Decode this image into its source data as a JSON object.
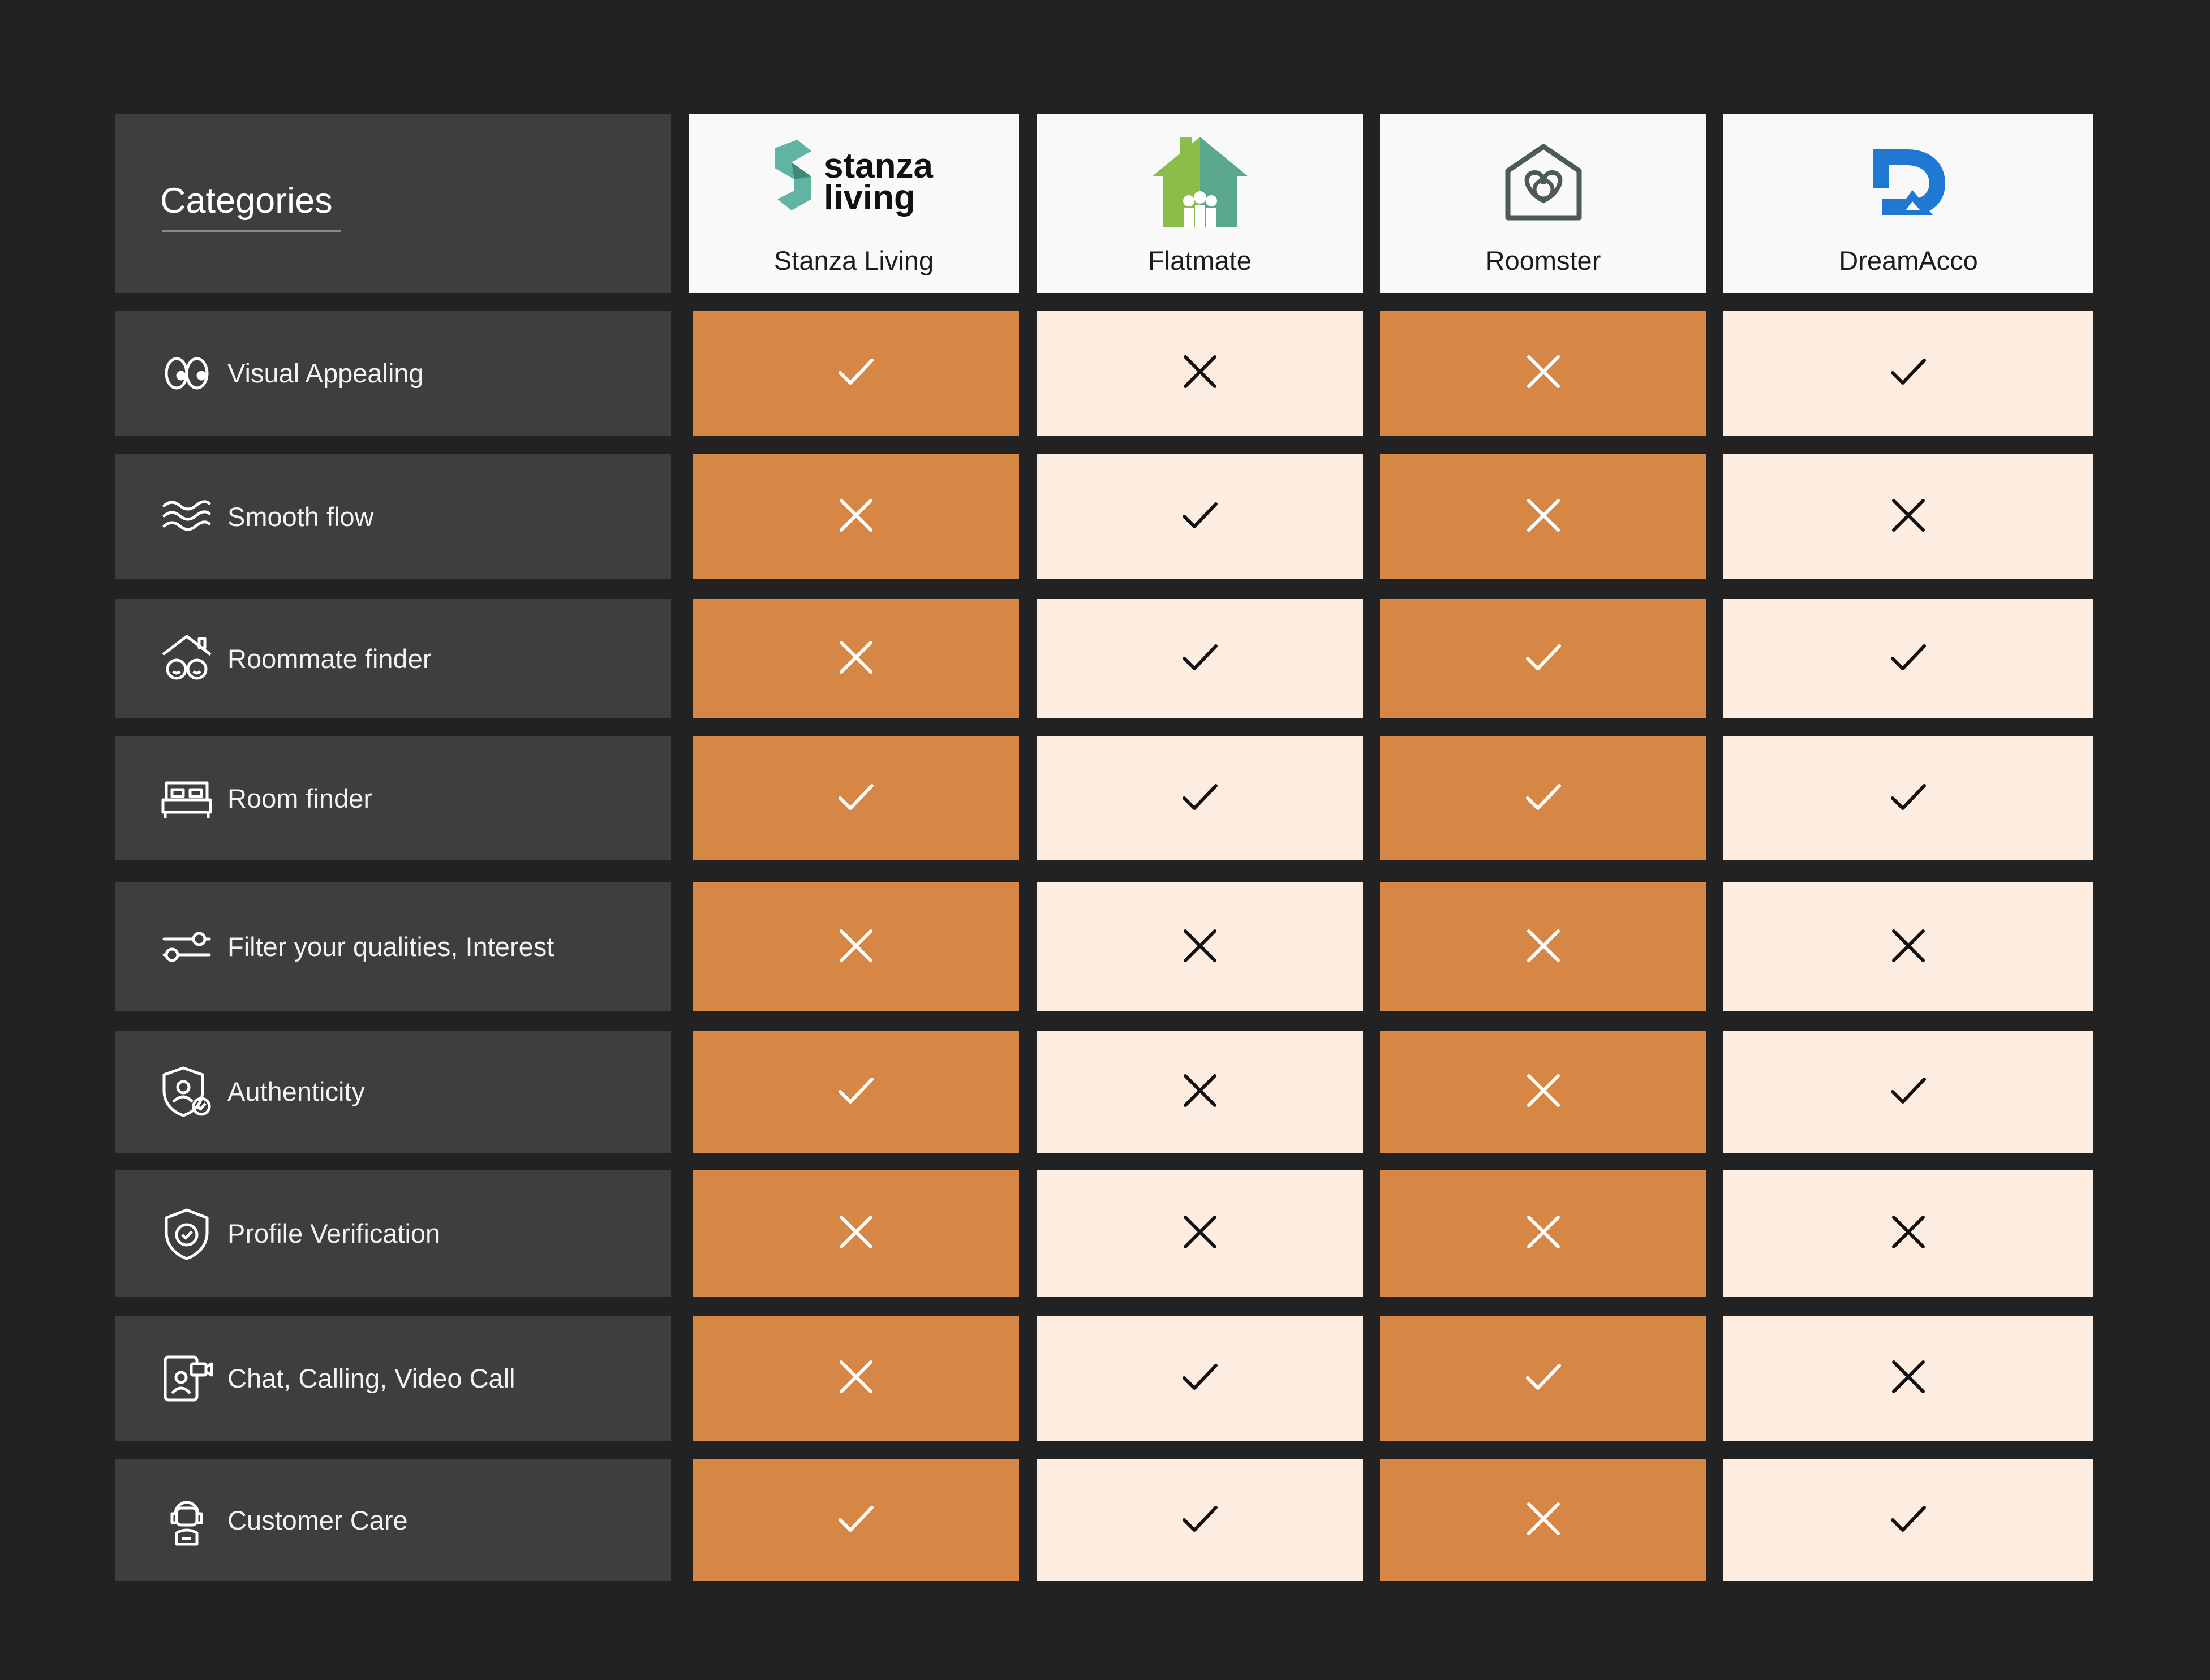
{
  "header": {
    "categories_label": "Categories"
  },
  "brands": [
    {
      "name": "Stanza Living",
      "logo_text_1": "stanza",
      "logo_text_2": "living",
      "logo": "stanza-living-logo"
    },
    {
      "name": "Flatmate",
      "logo": "flatmate-house-logo"
    },
    {
      "name": "Roomster",
      "logo": "roomster-logo"
    },
    {
      "name": "DreamAcco",
      "logo": "dreamacco-logo"
    }
  ],
  "colors": {
    "background": "#222222",
    "panel": "#3e3e3e",
    "orange": "#d68645",
    "cream": "#fdede0"
  },
  "rows": [
    {
      "label": "Visual Appealing",
      "icon": "eyes-icon",
      "values": [
        true,
        false,
        false,
        true
      ]
    },
    {
      "label": "Smooth flow",
      "icon": "waves-icon",
      "values": [
        false,
        true,
        false,
        false
      ]
    },
    {
      "label": "Roommate finder",
      "icon": "roommates-house-icon",
      "values": [
        false,
        true,
        true,
        true
      ]
    },
    {
      "label": "Room finder",
      "icon": "bed-icon",
      "values": [
        true,
        true,
        true,
        true
      ]
    },
    {
      "label": "Filter your qualities, Interest",
      "icon": "filter-sliders-icon",
      "values": [
        false,
        false,
        false,
        false
      ]
    },
    {
      "label": "Authenticity",
      "icon": "user-shield-check-icon",
      "values": [
        true,
        false,
        false,
        true
      ]
    },
    {
      "label": "Profile Verification",
      "icon": "shield-check-icon",
      "values": [
        false,
        false,
        false,
        false
      ]
    },
    {
      "label": "Chat, Calling, Video Call",
      "icon": "video-call-icon",
      "values": [
        false,
        true,
        true,
        false
      ]
    },
    {
      "label": "Customer Care",
      "icon": "headset-agent-icon",
      "values": [
        true,
        true,
        false,
        true
      ]
    }
  ]
}
